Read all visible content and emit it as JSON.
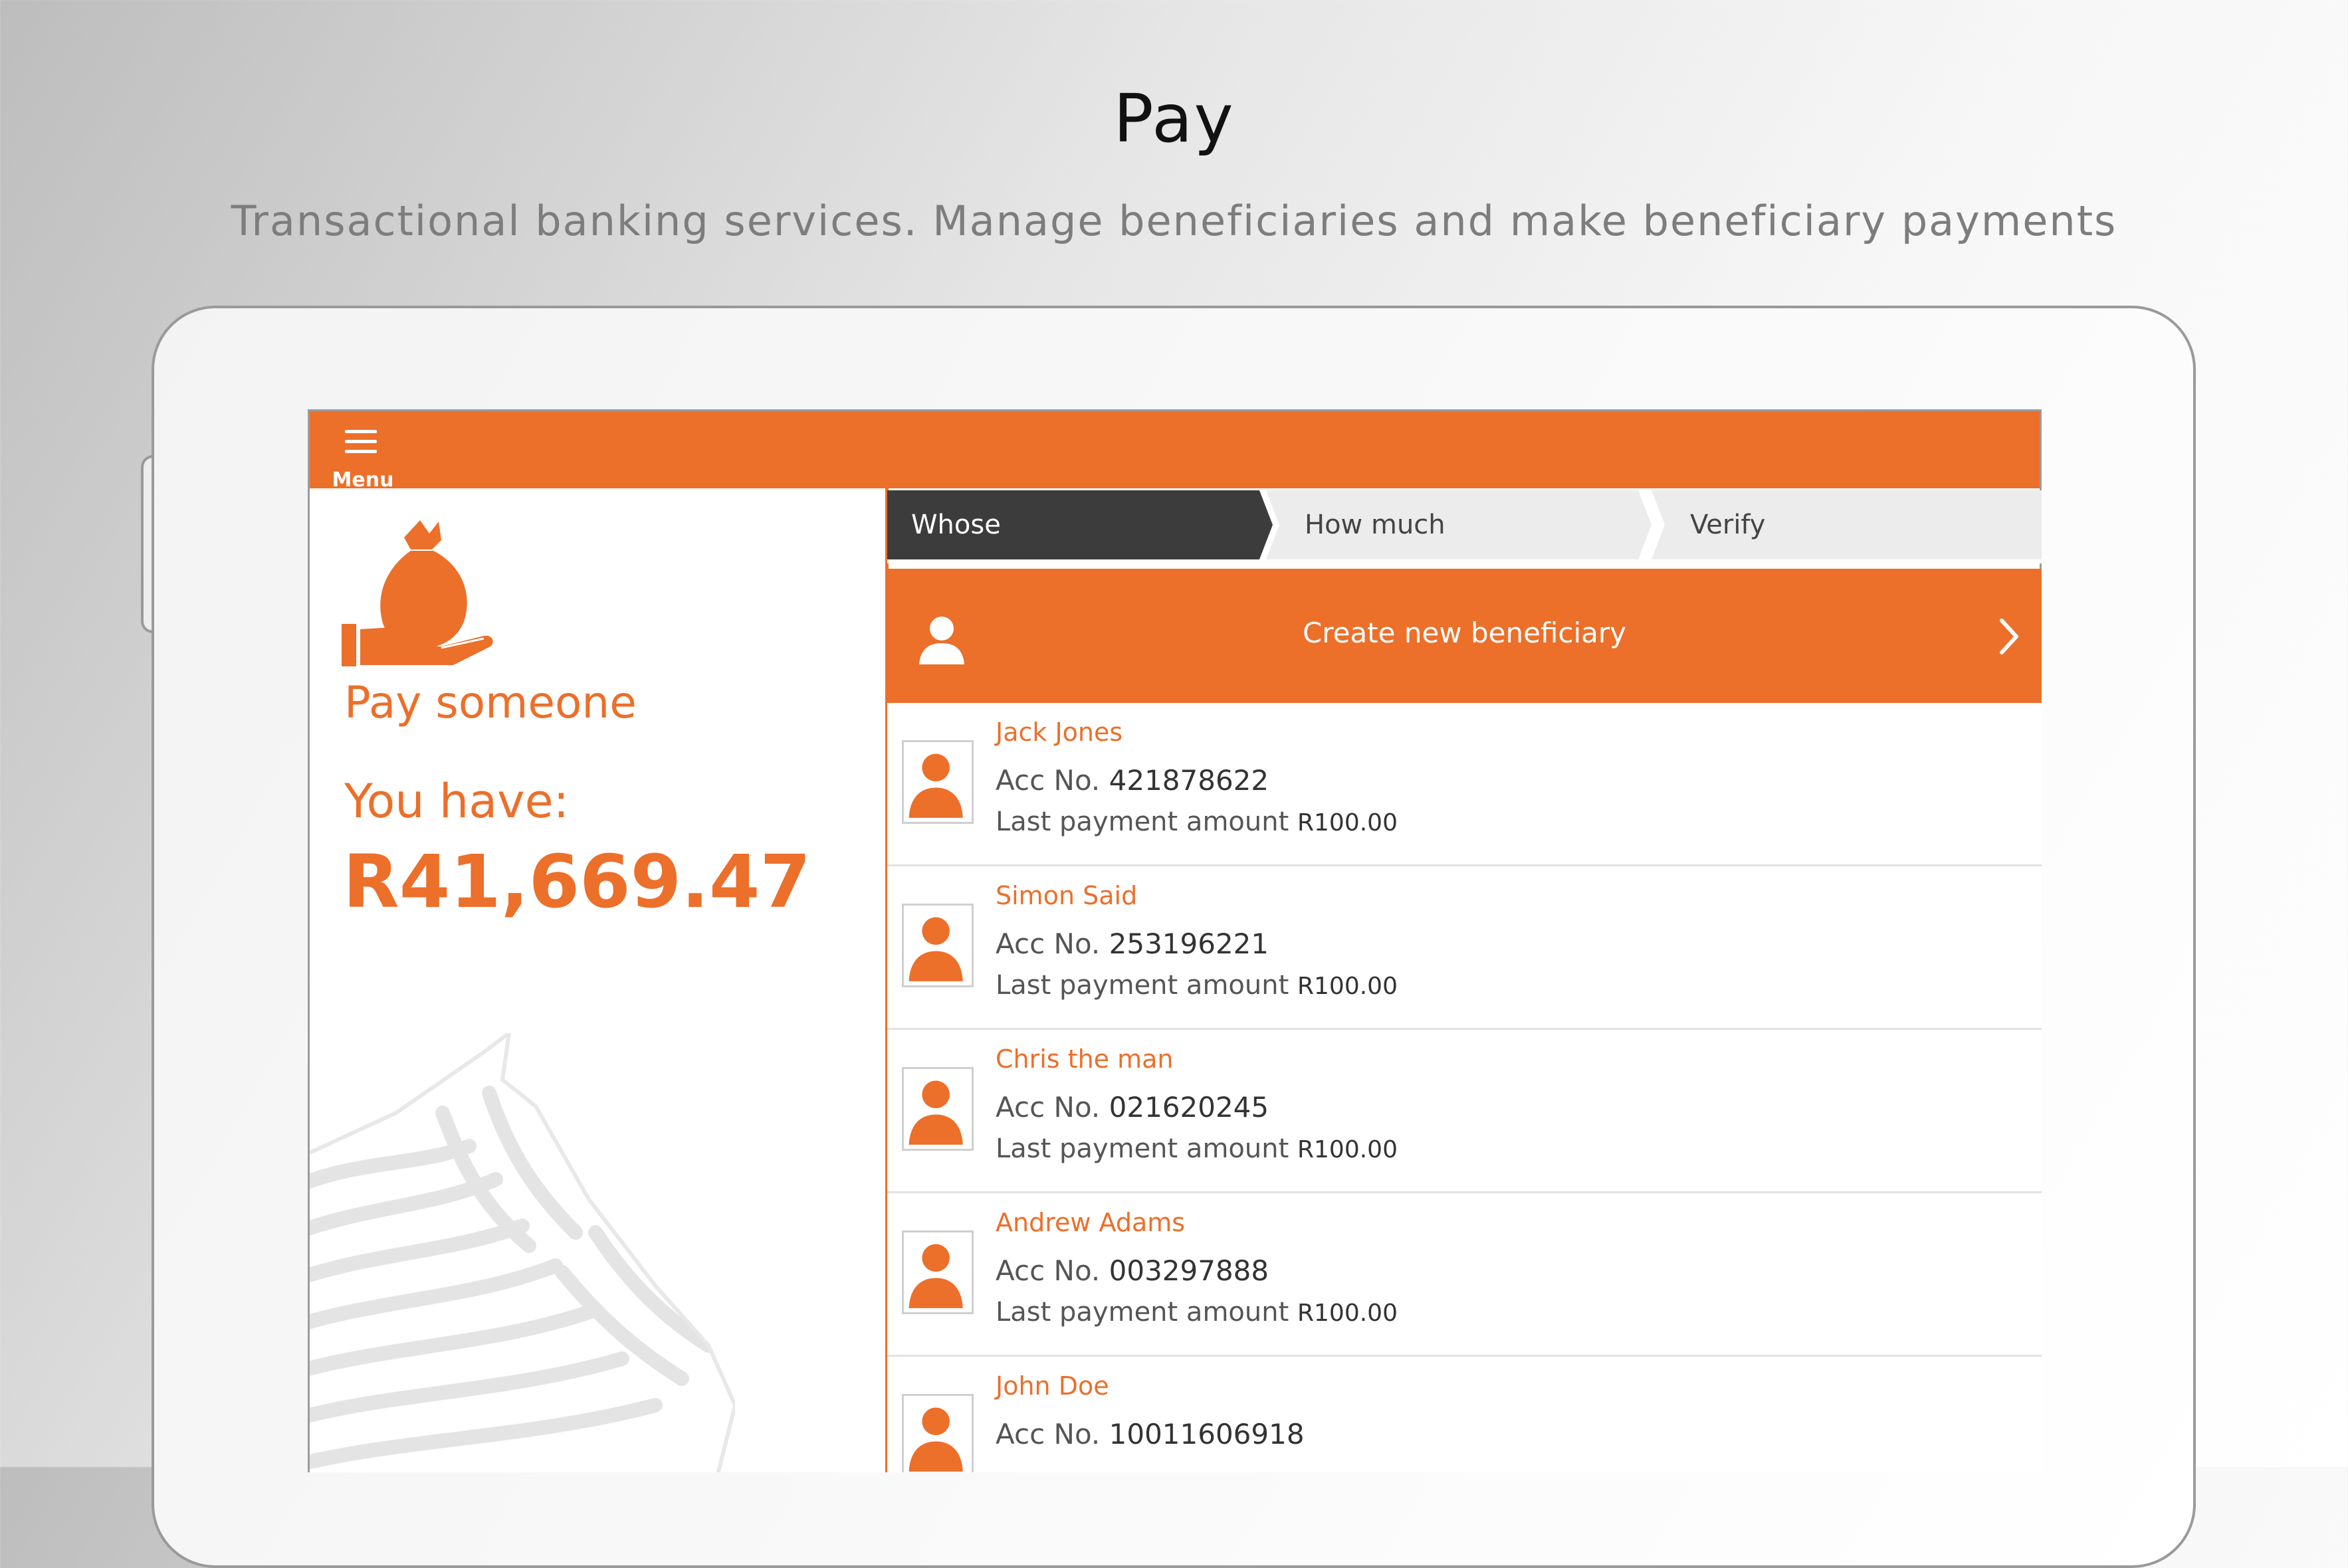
{
  "header": {
    "title": "Pay",
    "subtitle": "Transactional banking services. Manage beneficiaries and make beneficiary payments"
  },
  "colors": {
    "accent": "#ec6f2a",
    "dark_step": "#3c3c3c",
    "light_step": "#ececec"
  },
  "app": {
    "menu_label": "Menu",
    "left": {
      "heading": "Pay someone",
      "balance_label": "You have:",
      "balance": "R41,669.47",
      "icon": "money-bag-hand-icon"
    },
    "steps": [
      "Whose",
      "How much",
      "Verify"
    ],
    "create_beneficiary_label": "Create new beneficiary",
    "acc_label": "Acc No.",
    "last_payment_label": "Last payment amount",
    "beneficiaries": [
      {
        "name": "Jack Jones",
        "acc": "421878622",
        "last_payment": "R100.00"
      },
      {
        "name": "Simon Said",
        "acc": "253196221",
        "last_payment": "R100.00"
      },
      {
        "name": "Chris the man",
        "acc": "021620245",
        "last_payment": "R100.00"
      },
      {
        "name": "Andrew Adams",
        "acc": "003297888",
        "last_payment": "R100.00"
      },
      {
        "name": "John Doe",
        "acc": "10011606918",
        "last_payment": ""
      }
    ]
  }
}
